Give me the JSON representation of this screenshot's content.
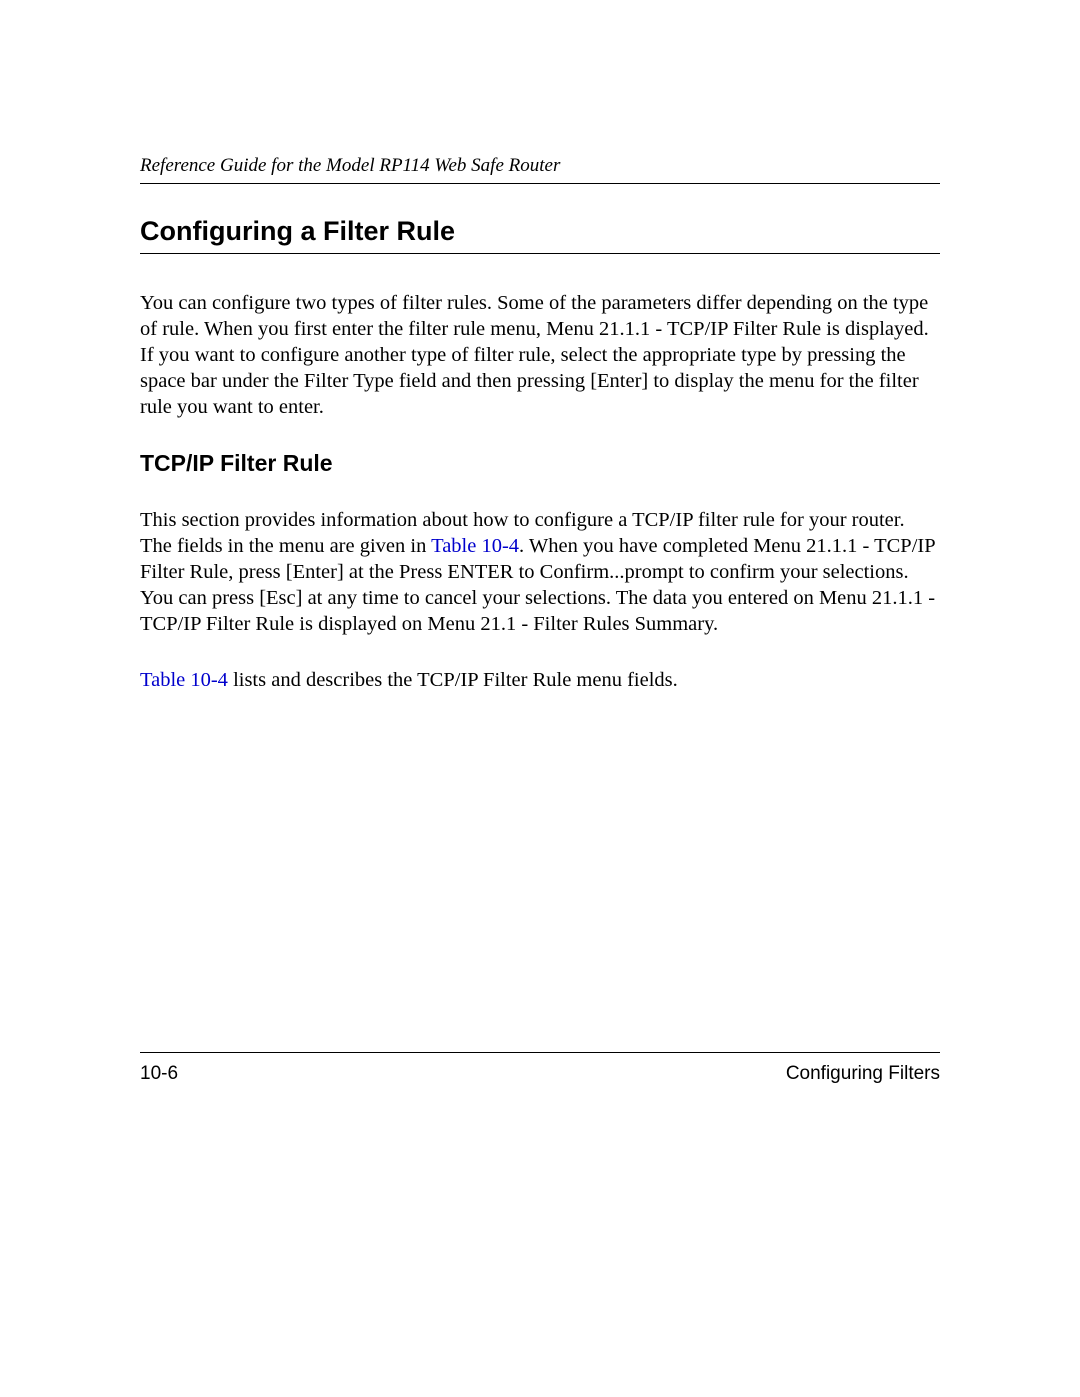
{
  "header": {
    "runningTitle": "Reference Guide for the Model RP114 Web Safe Router"
  },
  "section": {
    "title": "Configuring a Filter Rule",
    "para1": "You can configure two types of filter rules. Some of the parameters differ depending on the type of rule. When you first enter the filter rule menu, Menu 21.1.1 - TCP/IP Filter Rule is displayed. If you want to configure another type of filter rule, select the appropriate type by pressing the space bar under the Filter Type field and then pressing [Enter] to display the menu for the filter rule you want to enter."
  },
  "subsection": {
    "title": "TCP/IP Filter Rule",
    "para2_pre": "This section provides information about how to configure a TCP/IP filter rule for your router. The fields in the menu are given in ",
    "link1": "Table 10-4",
    "para2_post": ". When you have completed Menu 21.1.1 - TCP/IP Filter Rule, press [Enter] at the Press ENTER to Confirm...prompt to confirm your selections. You can press [Esc] at any time to cancel your selections. The data you entered on Menu 21.1.1 - TCP/IP Filter Rule is displayed on Menu 21.1 - Filter Rules Summary.",
    "para3_link": "Table 10-4",
    "para3_post": " lists and describes the TCP/IP Filter Rule menu fields."
  },
  "footer": {
    "pageNumber": "10-6",
    "chapterTitle": "Configuring Filters"
  }
}
